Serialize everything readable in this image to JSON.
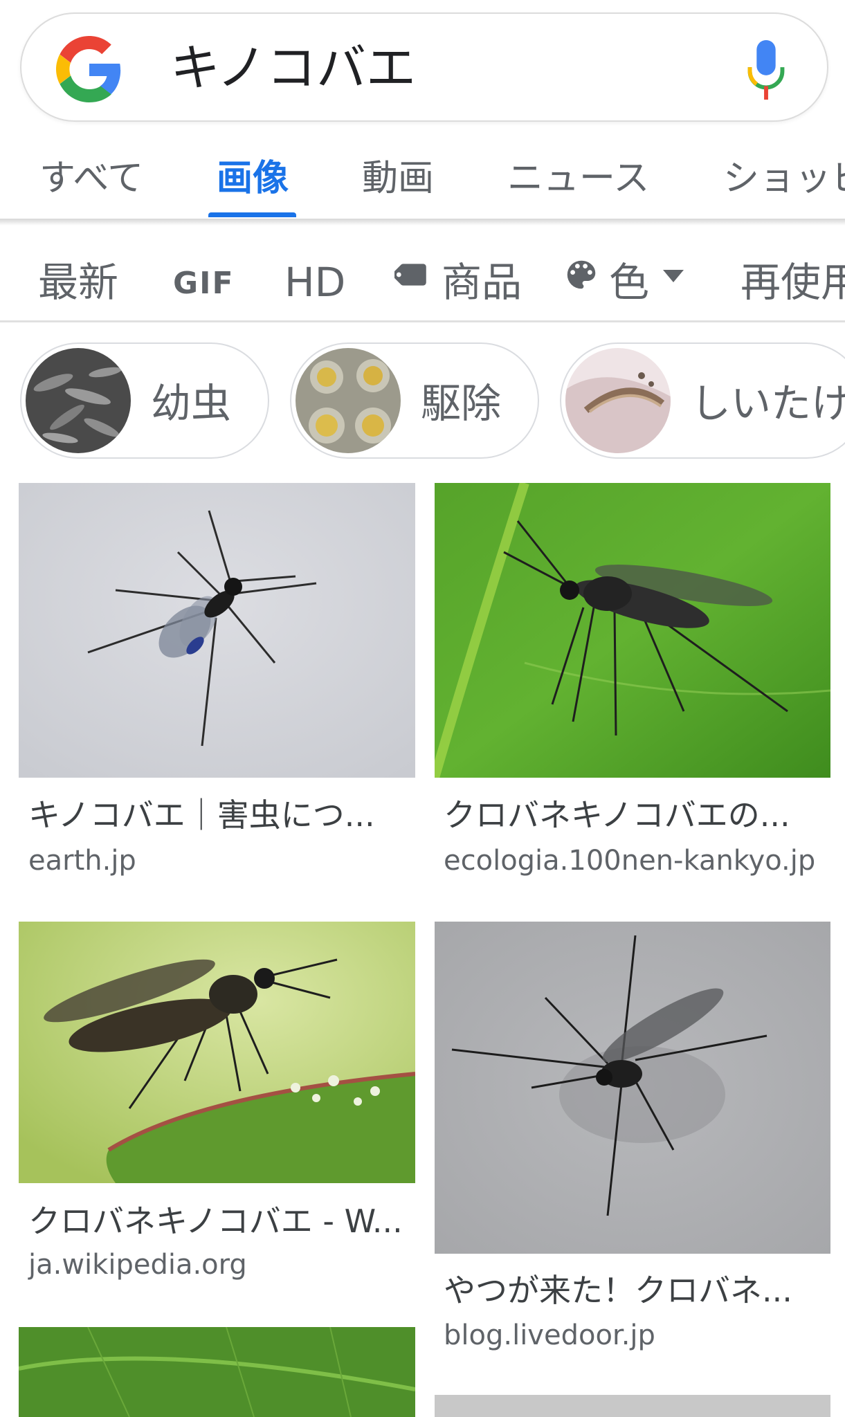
{
  "search": {
    "query": "キノコバエ"
  },
  "tabs": [
    {
      "label": "すべて"
    },
    {
      "label": "画像"
    },
    {
      "label": "動画"
    },
    {
      "label": "ニュース"
    },
    {
      "label": "ショッピ"
    }
  ],
  "filters": [
    {
      "label": "最新"
    },
    {
      "label": "GIF"
    },
    {
      "label": "HD"
    },
    {
      "label": "商品"
    },
    {
      "label": "色"
    },
    {
      "label": "再使用"
    }
  ],
  "chips": [
    {
      "label": "幼虫"
    },
    {
      "label": "駆除"
    },
    {
      "label": "しいたけ"
    }
  ],
  "results": [
    {
      "title": "キノコバエ｜害虫につ...",
      "source": "earth.jp"
    },
    {
      "title": "クロバネキノコバエの...",
      "source": "ecologia.100nen-kankyo.jp"
    },
    {
      "title": "クロバネキノコバエ - W...",
      "source": "ja.wikipedia.org"
    },
    {
      "title": "やつが来た！クロバネ...",
      "source": "blog.livedoor.jp"
    }
  ],
  "colors": {
    "accent": "#1a73e8",
    "text_muted": "#5f6368"
  }
}
